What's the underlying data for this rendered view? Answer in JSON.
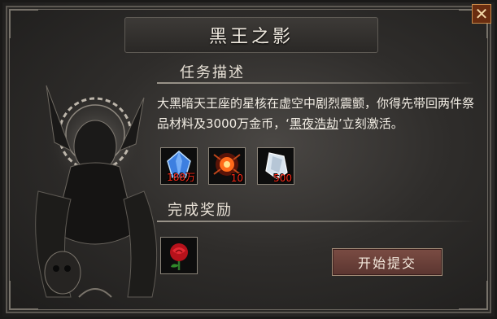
{
  "window": {
    "title": "黑王之影",
    "close_label": "✕"
  },
  "task": {
    "heading": "任务描述",
    "text_before": "大黑暗天王座的星核在虚空中剧烈震颤，你得先带回两件祭品材料及3000万金币，‘",
    "highlight": "黑夜浩劫",
    "text_after": "’立刻激活。",
    "items": [
      {
        "icon": "blue-crystal-icon",
        "count": "188万"
      },
      {
        "icon": "fire-orb-icon",
        "count": "10"
      },
      {
        "icon": "white-crystal-icon",
        "count": "500"
      }
    ]
  },
  "reward": {
    "heading": "完成奖励",
    "items": [
      {
        "icon": "red-rose-icon"
      }
    ]
  },
  "actions": {
    "submit_label": "开始提交"
  },
  "colors": {
    "count_text": "#ff2a18",
    "button_bg": "#6a403a",
    "panel_bg": "#2f2d2b"
  }
}
